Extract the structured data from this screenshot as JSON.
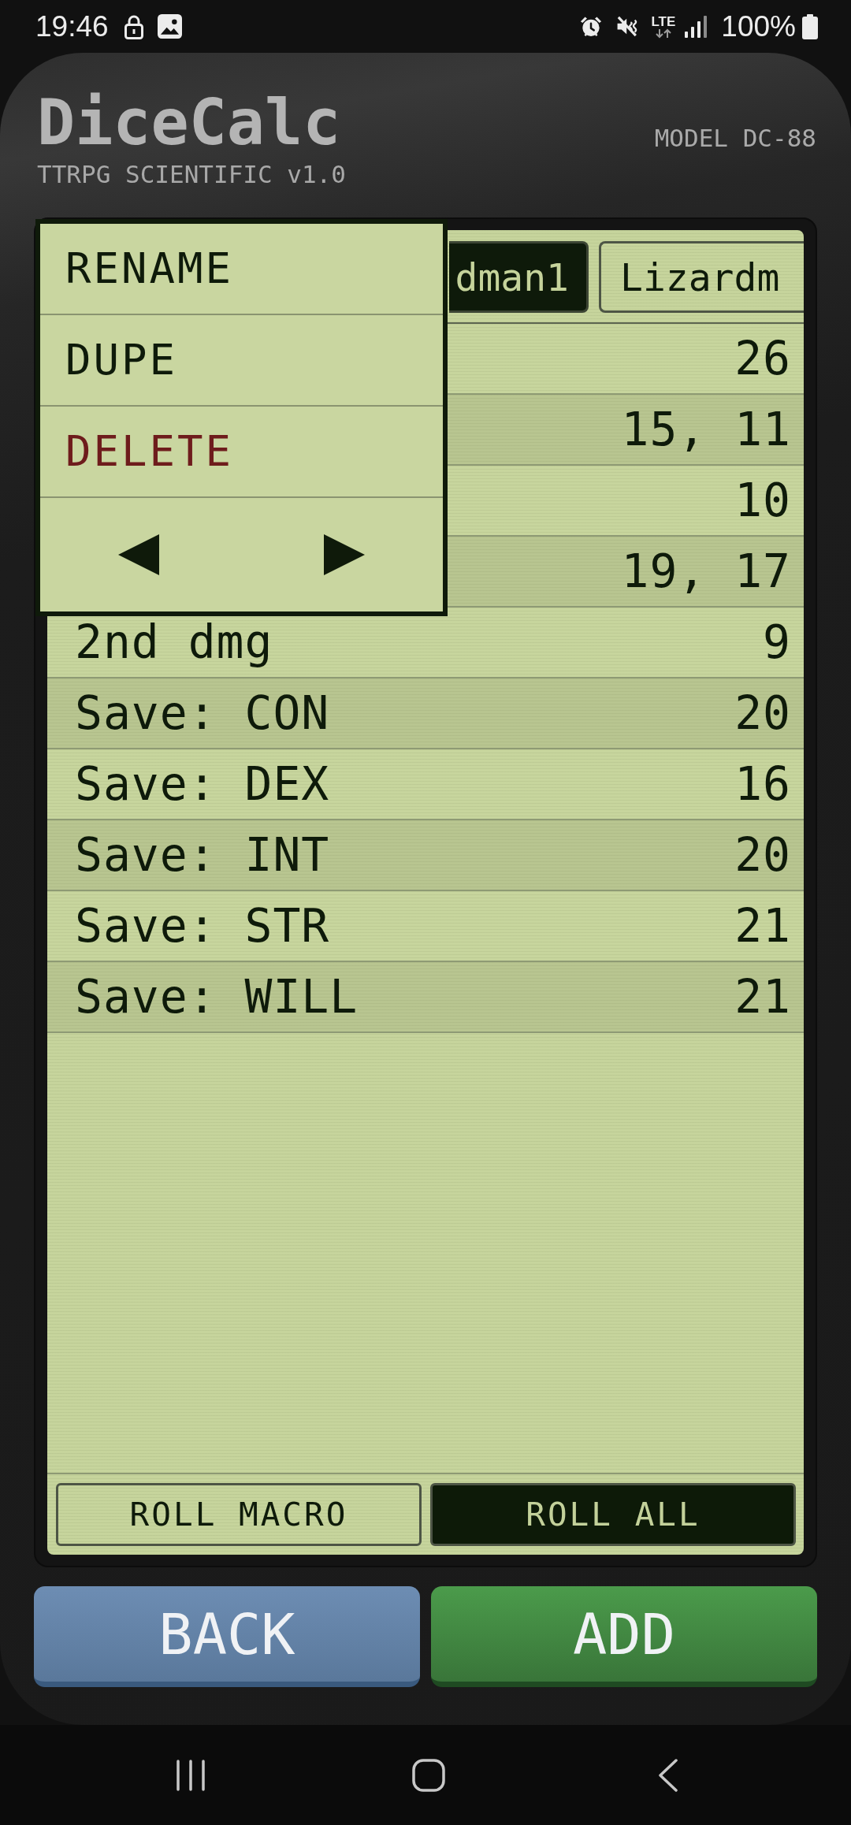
{
  "status_bar": {
    "time": "19:46",
    "network": "LTE",
    "battery": "100%"
  },
  "header": {
    "title": "DiceCalc",
    "subtitle": "TTRPG SCIENTIFIC v1.0",
    "model": "MODEL DC-88"
  },
  "tabs": [
    {
      "label": "dman1",
      "selected": true
    },
    {
      "label": "Lizardm",
      "selected": false
    }
  ],
  "context_menu": {
    "items": [
      {
        "label": "RENAME",
        "kind": "normal"
      },
      {
        "label": "DUPE",
        "kind": "normal"
      },
      {
        "label": "DELETE",
        "kind": "danger"
      }
    ]
  },
  "rows": [
    {
      "value": "26"
    },
    {
      "value": "15, 11"
    },
    {
      "value": "10"
    },
    {
      "value": "19, 17"
    },
    {
      "label": "2nd dmg",
      "value": "9"
    },
    {
      "label": "Save: CON",
      "value": "20"
    },
    {
      "label": "Save: DEX",
      "value": "16"
    },
    {
      "label": "Save: INT",
      "value": "20"
    },
    {
      "label": "Save: STR",
      "value": "21"
    },
    {
      "label": "Save: WILL",
      "value": "21"
    }
  ],
  "screen_buttons": [
    {
      "label": "ROLL MACRO",
      "kind": "outline"
    },
    {
      "label": "ROLL ALL",
      "kind": "filled"
    }
  ],
  "actions": [
    {
      "label": "BACK",
      "kind": "secondary"
    },
    {
      "label": "ADD",
      "kind": "primary"
    }
  ]
}
